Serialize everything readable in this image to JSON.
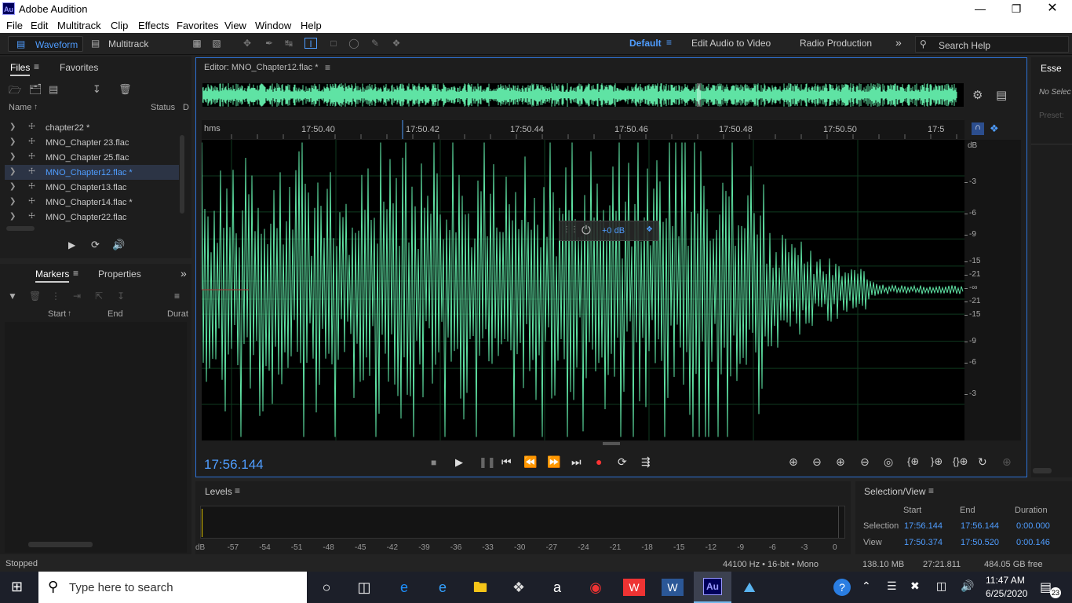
{
  "window": {
    "app_title": "Adobe Audition",
    "logo": "Au"
  },
  "menu": [
    "File",
    "Edit",
    "Multitrack",
    "Clip",
    "Effects",
    "Favorites",
    "View",
    "Window",
    "Help"
  ],
  "toolbar": {
    "waveform_label": "Waveform",
    "multitrack_label": "Multitrack",
    "workspaces": [
      "Default",
      "Edit Audio to Video",
      "Radio Production"
    ],
    "search_placeholder": "Search Help"
  },
  "files_panel": {
    "tabs": [
      "Files",
      "Favorites"
    ],
    "col_name": "Name",
    "col_status": "Status",
    "col_d": "D",
    "items": [
      {
        "name": "chapter22 *",
        "selected": false
      },
      {
        "name": "MNO_Chapter 23.flac",
        "selected": false
      },
      {
        "name": "MNO_Chapter 25.flac",
        "selected": false
      },
      {
        "name": "MNO_Chapter12.flac *",
        "selected": true
      },
      {
        "name": "MNO_Chapter13.flac",
        "selected": false
      },
      {
        "name": "MNO_Chapter14.flac *",
        "selected": false
      },
      {
        "name": "MNO_Chapter22.flac",
        "selected": false
      }
    ]
  },
  "markers_panel": {
    "tabs": [
      "Markers",
      "Properties"
    ],
    "cols": [
      "Start",
      "End",
      "Durat"
    ]
  },
  "editor": {
    "title": "Editor: MNO_Chapter12.flac *",
    "ruler_unit": "hms",
    "ruler_ticks": [
      "17:50.40",
      "17:50.42",
      "17:50.44",
      "17:50.46",
      "17:50.48",
      "17:50.50",
      "17:5"
    ],
    "db_labels": [
      "dB",
      "-3",
      "-6",
      "-9",
      "-15",
      "-21",
      "-∞",
      "-21",
      "-15",
      "-9",
      "-6",
      "-3"
    ],
    "hud_gain": "+0 dB",
    "current_time": "17:56.144"
  },
  "levels": {
    "title": "Levels",
    "scale": [
      "dB",
      "-57",
      "-54",
      "-51",
      "-48",
      "-45",
      "-42",
      "-39",
      "-36",
      "-33",
      "-30",
      "-27",
      "-24",
      "-21",
      "-18",
      "-15",
      "-12",
      "-9",
      "-6",
      "-3",
      "0"
    ]
  },
  "selection_view": {
    "title": "Selection/View",
    "headers": [
      "Start",
      "End",
      "Duration"
    ],
    "rows": [
      {
        "label": "Selection",
        "start": "17:56.144",
        "end": "17:56.144",
        "duration": "0:00.000"
      },
      {
        "label": "View",
        "start": "17:50.374",
        "end": "17:50.520",
        "duration": "0:00.146"
      }
    ]
  },
  "right_panel": {
    "tab": "Esse",
    "no_selection": "No Selec",
    "preset": "Preset:"
  },
  "status": {
    "state": "Stopped",
    "format": "44100 Hz • 16-bit • Mono",
    "size": "138.10 MB",
    "duration": "27:21.811",
    "free": "484.05 GB free"
  },
  "taskbar": {
    "search_placeholder": "Type here to search",
    "time": "11:47 AM",
    "date": "6/25/2020",
    "notifications": "23",
    "apps": [
      "task-view",
      "edge",
      "ie",
      "explorer",
      "dropbox",
      "amazon",
      "chrome",
      "wps",
      "word",
      "audition",
      "photos"
    ]
  },
  "colors": {
    "wave": "#5fe3a4",
    "accent": "#4f9dff",
    "record": "#ff3333"
  }
}
